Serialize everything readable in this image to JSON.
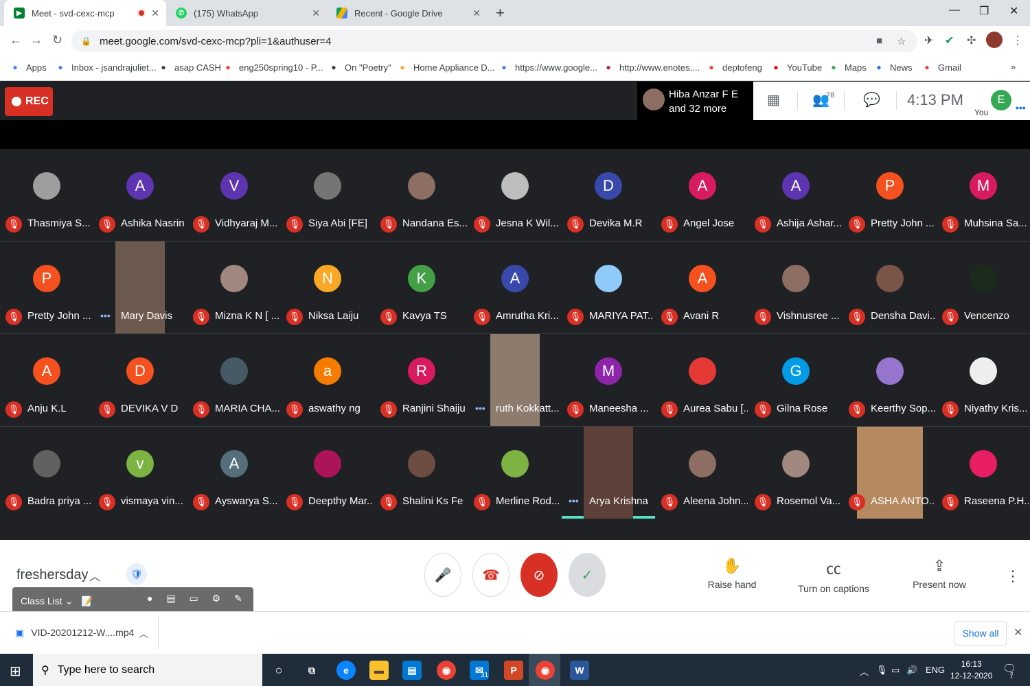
{
  "browser": {
    "tabs": [
      {
        "title": "Meet - svd-cexc-mcp",
        "active": true
      },
      {
        "title": "(175) WhatsApp",
        "active": false
      },
      {
        "title": "Recent - Google Drive",
        "active": false
      }
    ],
    "url": "meet.google.com/svd-cexc-mcp?pli=1&authuser=4",
    "bookmarks": [
      {
        "label": "Apps",
        "icon": "apps-grid-icon",
        "color": "#4285f4"
      },
      {
        "label": "Inbox - jsandrajuliet...",
        "icon": "google-icon",
        "color": "#4285f4"
      },
      {
        "label": "asap CASH",
        "icon": "globe-icon",
        "color": "#3c4043"
      },
      {
        "label": "eng250spring10 - P...",
        "icon": "pinwheel-icon",
        "color": "#ea4335"
      },
      {
        "label": "On \"Poetry\"",
        "icon": "p-icon",
        "color": "#3c4043"
      },
      {
        "label": "Home Appliance D...",
        "icon": "jd-icon",
        "color": "#f9a825"
      },
      {
        "label": "https://www.google...",
        "icon": "google-icon",
        "color": "#4285f4"
      },
      {
        "label": "http://www.enotes....",
        "icon": "e-icon",
        "color": "#c2185b"
      },
      {
        "label": "deptofeng",
        "icon": "gmail-icon",
        "color": "#ea4335"
      },
      {
        "label": "YouTube",
        "icon": "youtube-icon",
        "color": "#ff0000"
      },
      {
        "label": "Maps",
        "icon": "maps-icon",
        "color": "#34a853"
      },
      {
        "label": "News",
        "icon": "news-icon",
        "color": "#1a73e8"
      },
      {
        "label": "Gmail",
        "icon": "gmail-icon",
        "color": "#ea4335"
      }
    ]
  },
  "meet": {
    "rec_label": "REC",
    "presenter_line1": "Hiba Anzar F E",
    "presenter_line2": "and 32 more",
    "participant_count": "78",
    "time": "4:13 PM",
    "you_label": "You",
    "you_initial": "E",
    "participants": [
      {
        "name": "Thasmiya S...",
        "initial": "",
        "color": "#9e9e9e",
        "photo": true
      },
      {
        "name": "Ashika Nasrin",
        "initial": "A",
        "color": "#5e35b1"
      },
      {
        "name": "Vidhyaraj M...",
        "initial": "V",
        "color": "#5e35b1"
      },
      {
        "name": "Siya Abi [FE]",
        "initial": "",
        "color": "#757575",
        "photo": true
      },
      {
        "name": "Nandana Es...",
        "initial": "",
        "color": "#8d6e63",
        "photo": true
      },
      {
        "name": "Jesna K Wil...",
        "initial": "",
        "color": "#bdbdbd",
        "photo": true
      },
      {
        "name": "Devika M.R",
        "initial": "D",
        "color": "#3949ab"
      },
      {
        "name": "Angel Jose",
        "initial": "A",
        "color": "#d81b60"
      },
      {
        "name": "Ashija Ashar...",
        "initial": "A",
        "color": "#5e35b1"
      },
      {
        "name": "Pretty John ...",
        "initial": "P",
        "color": "#f4511e"
      },
      {
        "name": "Muhsina Sa...",
        "initial": "M",
        "color": "#d81b60"
      },
      {
        "name": "Pretty John ...",
        "initial": "P",
        "color": "#f4511e"
      },
      {
        "name": "Mary Davis",
        "initial": "",
        "color": "#6d5a4e",
        "video": true,
        "talking": true
      },
      {
        "name": "Mizna K N [ ...",
        "initial": "",
        "color": "#a1887f",
        "photo": true
      },
      {
        "name": "Niksa Laiju",
        "initial": "N",
        "color": "#f9a825",
        "photo": true
      },
      {
        "name": "Kavya TS",
        "initial": "K",
        "color": "#43a047"
      },
      {
        "name": "Amrutha Kri...",
        "initial": "A",
        "color": "#3949ab"
      },
      {
        "name": "MARIYA PAT...",
        "initial": "",
        "color": "#90caf9",
        "photo": true
      },
      {
        "name": "Avani R",
        "initial": "A",
        "color": "#f4511e"
      },
      {
        "name": "Vishnusree ...",
        "initial": "",
        "color": "#8d6e63",
        "photo": true
      },
      {
        "name": "Densha Davi...",
        "initial": "",
        "color": "#795548",
        "photo": true
      },
      {
        "name": "Vencenzo",
        "initial": "",
        "color": "#1b2b1b",
        "photo": true
      },
      {
        "name": "Anju K.L",
        "initial": "A",
        "color": "#f4511e"
      },
      {
        "name": "DEVIKA V D",
        "initial": "D",
        "color": "#f4511e"
      },
      {
        "name": "MARIA CHA...",
        "initial": "",
        "color": "#455a64",
        "photo": true
      },
      {
        "name": "aswathy ng",
        "initial": "a",
        "color": "#f57c00"
      },
      {
        "name": "Ranjini Shaiju",
        "initial": "R",
        "color": "#d81b60"
      },
      {
        "name": "ruth Kokkatt...",
        "initial": "",
        "color": "#8d7b6e",
        "video": true,
        "talking": true
      },
      {
        "name": "Maneesha ...",
        "initial": "M",
        "color": "#8e24aa"
      },
      {
        "name": "Aurea Sabu [...",
        "initial": "",
        "color": "#e53935",
        "photo": true
      },
      {
        "name": "Gilna Rose",
        "initial": "G",
        "color": "#039be5"
      },
      {
        "name": "Keerthy Sop...",
        "initial": "",
        "color": "#9575cd",
        "photo": true
      },
      {
        "name": "Niyathy Kris...",
        "initial": "",
        "color": "#eeeeee",
        "photo": true
      },
      {
        "name": "Badra priya ...",
        "initial": "",
        "color": "#616161",
        "photo": true
      },
      {
        "name": "vismaya vin...",
        "initial": "v",
        "color": "#7cb342"
      },
      {
        "name": "Ayswarya S...",
        "initial": "A",
        "color": "#546e7a"
      },
      {
        "name": "Deepthy Mar...",
        "initial": "",
        "color": "#ad1457",
        "photo": true
      },
      {
        "name": "Shalini Ks Fe",
        "initial": "",
        "color": "#6d4c41",
        "photo": true
      },
      {
        "name": "Merline Rod...",
        "initial": "",
        "color": "#7cb342",
        "photo": true
      },
      {
        "name": "Arya Krishna",
        "initial": "",
        "color": "#5d4037",
        "video": true,
        "talking": true,
        "active": true
      },
      {
        "name": "Aleena John...",
        "initial": "",
        "color": "#8d6e63",
        "photo": true
      },
      {
        "name": "Rosemol Va...",
        "initial": "",
        "color": "#a1887f",
        "photo": true
      },
      {
        "name": "ASHA ANTO...",
        "initial": "",
        "color": "#b58a60",
        "video": true
      },
      {
        "name": "Raseena P.H...",
        "initial": "",
        "color": "#e91e63",
        "photo": true
      }
    ]
  },
  "controls": {
    "meeting_name": "freshersday",
    "classlist_label": "Class List",
    "raise_hand": "Raise hand",
    "captions": "Turn on captions",
    "present": "Present now"
  },
  "downloads": {
    "file": "VID-20201212-W....mp4",
    "show_all": "Show all"
  },
  "taskbar": {
    "search_placeholder": "Type here to search",
    "lang": "ENG",
    "time": "16:13",
    "date": "12-12-2020",
    "notif_count": "7",
    "calendar_badge": "31"
  }
}
